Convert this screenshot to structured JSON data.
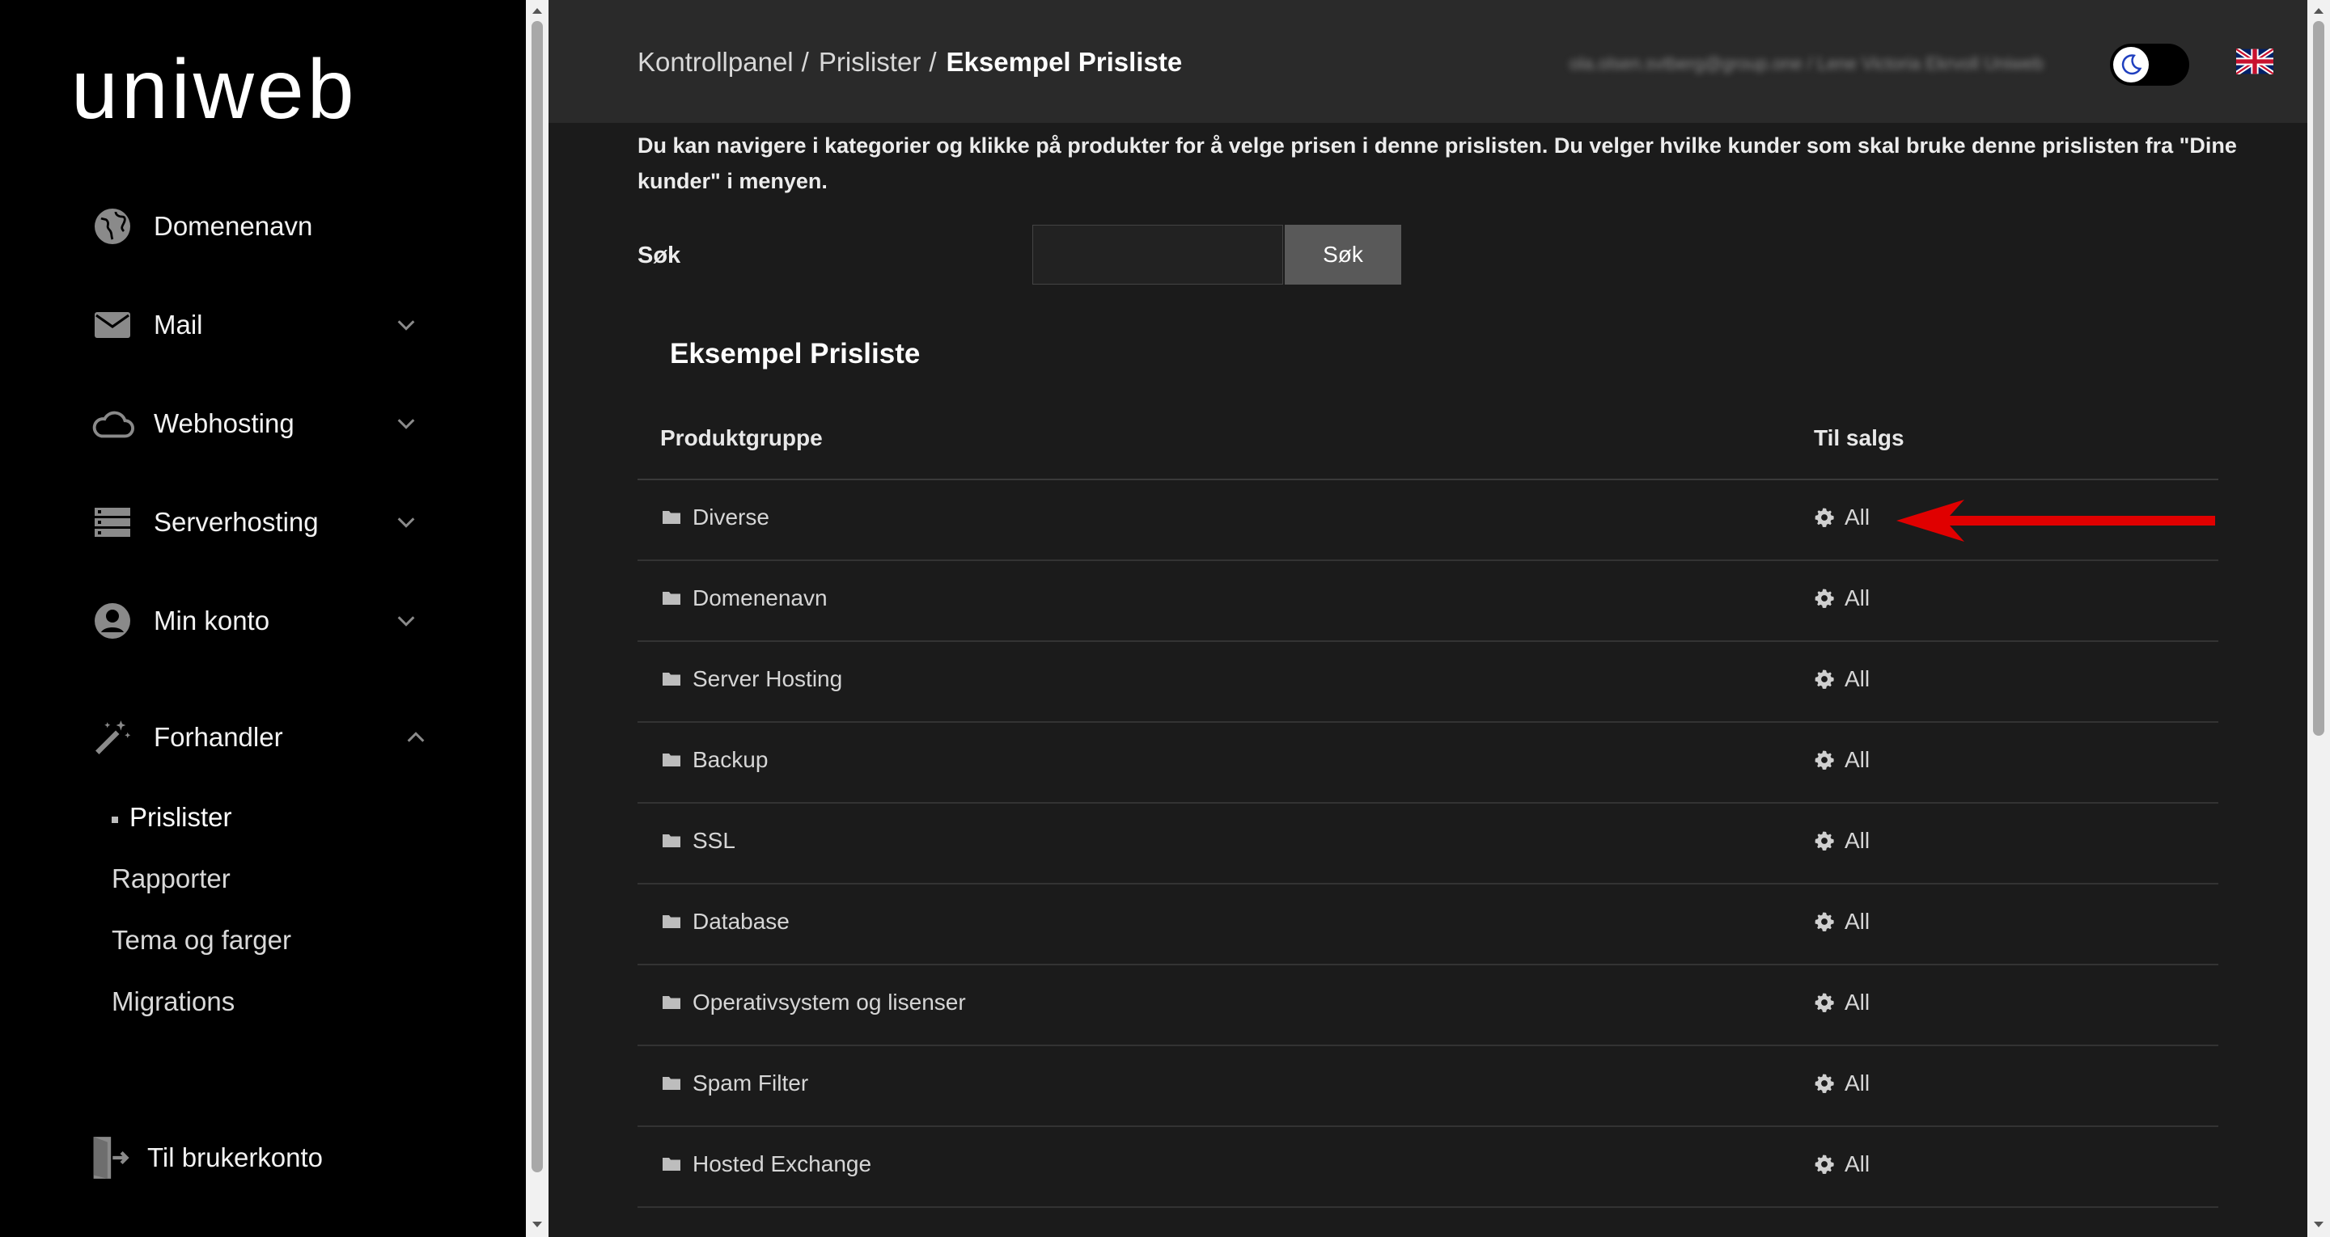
{
  "brand": {
    "logo_text": "uniweb"
  },
  "sidebar": {
    "items": [
      {
        "label": "Domenenavn",
        "icon": "globe-icon",
        "has_chevron": false
      },
      {
        "label": "Mail",
        "icon": "mail-icon",
        "has_chevron": true
      },
      {
        "label": "Webhosting",
        "icon": "cloud-icon",
        "has_chevron": true
      },
      {
        "label": "Serverhosting",
        "icon": "server-icon",
        "has_chevron": true
      },
      {
        "label": "Min konto",
        "icon": "account-icon",
        "has_chevron": true
      },
      {
        "label": "Forhandler",
        "icon": "magic-wand-icon",
        "has_chevron": true,
        "expanded": true
      }
    ],
    "sub_items": [
      {
        "label": "Prislister",
        "active": true
      },
      {
        "label": "Rapporter",
        "active": false
      },
      {
        "label": "Tema og farger",
        "active": false
      },
      {
        "label": "Migrations",
        "active": false
      }
    ],
    "bottom_link": {
      "label": "Til brukerkonto",
      "icon": "exit-door-icon"
    }
  },
  "header": {
    "breadcrumb": {
      "first": "Kontrollpanel",
      "second": "Prislister",
      "current": "Eksempel Prisliste",
      "separator": "/"
    },
    "user_text": "ola.olsen.svtberg@group.one / Lene Victoria Ekrvoll Uniweb",
    "theme_toggle_icon": "moon-icon",
    "language_flag_icon": "uk-flag-icon"
  },
  "intro_text": "Du kan navigere i kategorier og klikke på produkter for å velge prisen i denne prislisten. Du velger hvilke kunder som skal bruke denne prislisten fra \"Dine kunder\" i menyen.",
  "search": {
    "label": "Søk",
    "value": "",
    "placeholder": "",
    "button_label": "Søk"
  },
  "pricelist": {
    "title": "Eksempel Prisliste",
    "columns": {
      "group": "Produktgruppe",
      "sale": "Til salgs"
    },
    "rows": [
      {
        "group": "Diverse",
        "sale": "All"
      },
      {
        "group": "Domenenavn",
        "sale": "All"
      },
      {
        "group": "Server Hosting",
        "sale": "All"
      },
      {
        "group": "Backup",
        "sale": "All"
      },
      {
        "group": "SSL",
        "sale": "All"
      },
      {
        "group": "Database",
        "sale": "All"
      },
      {
        "group": "Operativsystem og lisenser",
        "sale": "All"
      },
      {
        "group": "Spam Filter",
        "sale": "All"
      },
      {
        "group": "Hosted Exchange",
        "sale": "All"
      }
    ]
  },
  "colors": {
    "sidebar_bg": "#000000",
    "main_bg": "#1b1b1b",
    "topbar_bg": "#2a2a2a",
    "annotation_arrow": "#e00000"
  }
}
